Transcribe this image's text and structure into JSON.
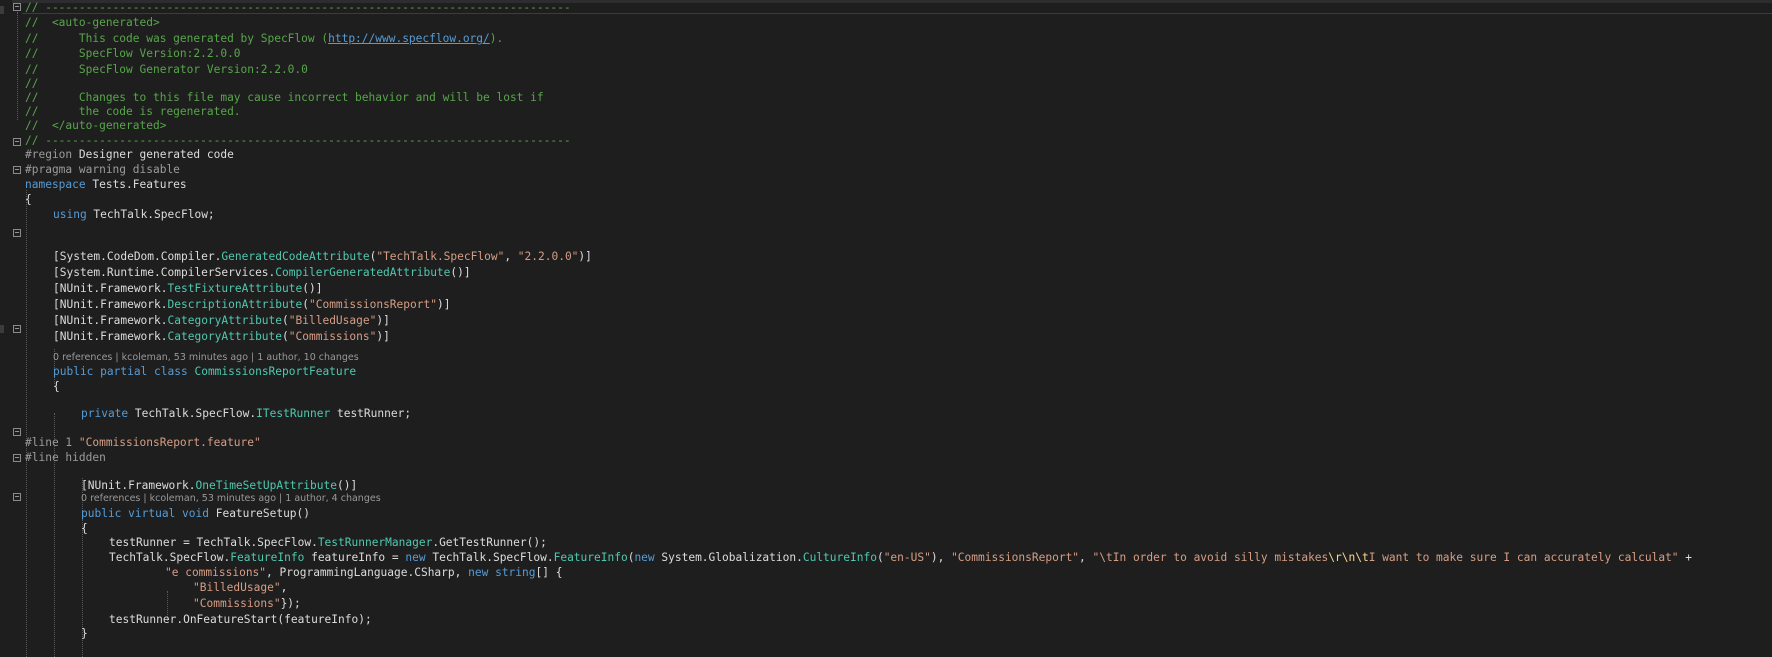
{
  "editor": {
    "file_lines": {
      "l1": "// ------------------------------------------------------------------------------",
      "l2a": "//  <auto-generated>",
      "l3a": "//      This code was generated by SpecFlow (",
      "l3link": "http://www.specflow.org/",
      "l3b": ").",
      "l4": "//      SpecFlow Version:2.2.0.0",
      "l5": "//      SpecFlow Generator Version:2.2.0.0",
      "l6": "//",
      "l7": "//      Changes to this file may cause incorrect behavior and will be lost if",
      "l8": "//      the code is regenerated.",
      "l9": "//  </auto-generated>",
      "l10": "// ------------------------------------------------------------------------------",
      "region_kw": "#region",
      "region_name": " Designer generated code",
      "pragma": "#pragma warning disable",
      "namespace_kw": "namespace",
      "namespace_name": " Tests.Features",
      "brace_open": "{",
      "using_kw": "using",
      "using_name": " TechTalk.SpecFlow;",
      "attr1_a": "[System.CodeDom.Compiler.",
      "attr1_t": "GeneratedCodeAttribute",
      "attr1_b": "(",
      "attr1_s1": "\"TechTalk.SpecFlow\"",
      "attr1_c": ", ",
      "attr1_s2": "\"2.2.0.0\"",
      "attr1_d": ")]",
      "attr2_a": "[System.Runtime.CompilerServices.",
      "attr2_t": "CompilerGeneratedAttribute",
      "attr2_b": "()]",
      "attr3_a": "[NUnit.Framework.",
      "attr3_t": "TestFixtureAttribute",
      "attr3_b": "()]",
      "attr4_a": "[NUnit.Framework.",
      "attr4_t": "DescriptionAttribute",
      "attr4_b": "(",
      "attr4_s": "\"CommissionsReport\"",
      "attr4_c": ")]",
      "attr5_a": "[NUnit.Framework.",
      "attr5_t": "CategoryAttribute",
      "attr5_b": "(",
      "attr5_s": "\"BilledUsage\"",
      "attr5_c": ")]",
      "attr6_a": "[NUnit.Framework.",
      "attr6_t": "CategoryAttribute",
      "attr6_b": "(",
      "attr6_s": "\"Commissions\"",
      "attr6_c": ")]",
      "class_kw": "public partial class",
      "class_name": "CommissionsReportFeature",
      "class_brace": "{",
      "field_kw": "private",
      "field_a": " TechTalk.SpecFlow.",
      "field_t": "ITestRunner",
      "field_b": " testRunner;",
      "line1_kw": "#line 1",
      "line1_s": " \"CommissionsReport.feature\"",
      "linehidden_kw": "#line",
      "linehidden_b": " hidden",
      "attr7_a": "[NUnit.Framework.",
      "attr7_t": "OneTimeSetUpAttribute",
      "attr7_b": "()]",
      "method_kw": "public virtual void",
      "method_name": " FeatureSetup()",
      "method_brace": "{",
      "tr_a": "testRunner = TechTalk.SpecFlow.",
      "tr_t": "TestRunnerManager",
      "tr_b": ".GetTestRunner();",
      "fi_a": "TechTalk.SpecFlow.",
      "fi_t1": "FeatureInfo",
      "fi_b": " featureInfo = ",
      "fi_new1": "new",
      "fi_c": " TechTalk.SpecFlow.",
      "fi_t2": "FeatureInfo",
      "fi_d": "(",
      "fi_new2": "new",
      "fi_e": " System.Globalization.",
      "fi_t3": "CultureInfo",
      "fi_f": "(",
      "fi_s1": "\"en-US\"",
      "fi_g": "), ",
      "fi_s2": "\"CommissionsReport\"",
      "fi_h": ", ",
      "fi_s3a": "\"\\tIn order to avoid silly mistakes",
      "fi_esc": "\\r\\n\\t",
      "fi_s3b": "I want to make sure I can accurately calculat\"",
      "fi_i": " +",
      "cont_s": "\"e commissions\"",
      "cont_a": ", ProgrammingLanguage.CSharp, ",
      "cont_new": "new",
      "cont_kw": " string",
      "cont_b": "[] {",
      "arr_s1": "\"BilledUsage\"",
      "arr_c1": ",",
      "arr_s2": "\"Commissions\"",
      "arr_c2": "});",
      "start": "testRunner.OnFeatureStart(featureInfo);",
      "method_close": "}"
    },
    "codelens": {
      "class_lens": "0 references | kcoleman, 53 minutes ago | 1 author, 10 changes",
      "method_lens": "0 references | kcoleman, 53 minutes ago | 1 author, 4 changes"
    }
  },
  "colors": {
    "background": "#1e1e1e",
    "comment": "#57a64a",
    "keyword": "#569cd6",
    "type": "#4ec9b0",
    "string": "#d69d85",
    "escape": "#ffd68f"
  }
}
